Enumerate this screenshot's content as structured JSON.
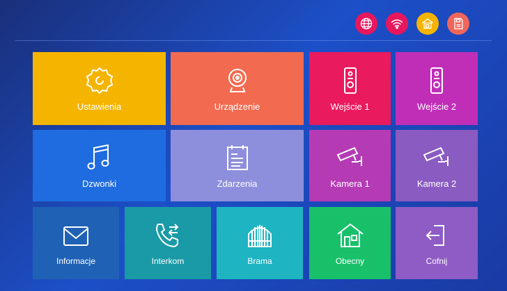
{
  "status_icons": [
    {
      "name": "globe-icon",
      "color": "#e8175d"
    },
    {
      "name": "wifi-icon",
      "color": "#e8175d"
    },
    {
      "name": "home-icon",
      "color": "#f5b400"
    },
    {
      "name": "sd-card-icon",
      "color": "#f0665a"
    }
  ],
  "tiles": {
    "ustawienia": {
      "label": "Ustawienia",
      "color": "#f5b400",
      "icon": "gear-icon"
    },
    "urzadzenie": {
      "label": "Urządzenie",
      "color": "#f26b50",
      "icon": "camera-icon"
    },
    "wejscie1": {
      "label": "Wejście 1",
      "color": "#ea1a5e",
      "icon": "doorbell-icon"
    },
    "wejscie2": {
      "label": "Wejście 2",
      "color": "#c02eb8",
      "icon": "doorbell-icon"
    },
    "dzwonki": {
      "label": "Dzwonki",
      "color": "#1f6ce0",
      "icon": "music-note-icon"
    },
    "zdarzenia": {
      "label": "Zdarzenia",
      "color": "#8e8fdc",
      "icon": "calendar-icon"
    },
    "kamera1": {
      "label": "Kamera 1",
      "color": "#b53bb5",
      "icon": "cctv-icon"
    },
    "kamera2": {
      "label": "Kamera 2",
      "color": "#8a5bc0",
      "icon": "cctv-icon"
    },
    "informacje": {
      "label": "Informacje",
      "color": "#1f62b5",
      "icon": "envelope-icon"
    },
    "interkom": {
      "label": "Interkom",
      "color": "#1a9aa6",
      "icon": "phone-transfer-icon"
    },
    "brama": {
      "label": "Brama",
      "color": "#1eb4c2",
      "icon": "gate-icon"
    },
    "obecny": {
      "label": "Obecny",
      "color": "#18c06a",
      "icon": "house-icon"
    },
    "cofnij": {
      "label": "Cofnij",
      "color": "#8e5cc4",
      "icon": "exit-icon"
    }
  }
}
